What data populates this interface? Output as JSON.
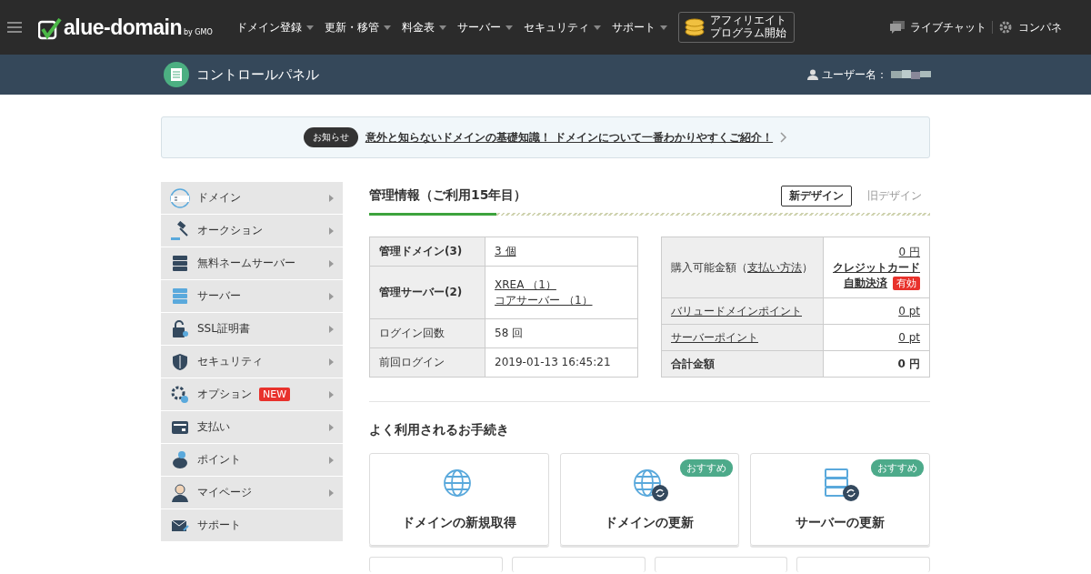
{
  "header": {
    "logo_main": "alue-domain",
    "logo_sub": "by GMO",
    "nav": [
      "ドメイン登録",
      "更新・移管",
      "料金表",
      "サーバー",
      "セキュリティ",
      "サポート"
    ],
    "affiliate": [
      "アフィリエイト",
      "プログラム開始"
    ],
    "live_chat": "ライブチャット",
    "control_panel": "コンパネ"
  },
  "subheader": {
    "title": "コントロールパネル",
    "user_label": "ユーザー名："
  },
  "notice": {
    "badge": "お知らせ",
    "text": "意外と知らないドメインの基礎知識！ ドメインについて一番わかりやすくご紹介！"
  },
  "sidebar": {
    "items": [
      {
        "label": "ドメイン",
        "arrow": true
      },
      {
        "label": "オークション",
        "arrow": true
      },
      {
        "label": "無料ネームサーバー",
        "arrow": true
      },
      {
        "label": "サーバー",
        "arrow": true
      },
      {
        "label": "SSL証明書",
        "arrow": true
      },
      {
        "label": "セキュリティ",
        "arrow": true
      },
      {
        "label": "オプション",
        "arrow": true,
        "badge": "NEW"
      },
      {
        "label": "支払い",
        "arrow": true
      },
      {
        "label": "ポイント",
        "arrow": true
      },
      {
        "label": "マイページ",
        "arrow": true
      },
      {
        "label": "サポート",
        "arrow": false
      }
    ]
  },
  "management": {
    "title": "管理情報（ご利用15年目）",
    "design_tabs": [
      {
        "label": "新デザイン",
        "selected": true
      },
      {
        "label": "旧デザイン",
        "selected": false
      }
    ],
    "left_table": [
      {
        "label": "管理ドメイン(3)",
        "bold": true,
        "values": [
          "3 個"
        ],
        "link": true
      },
      {
        "label": "管理サーバー(2)",
        "bold": true,
        "values": [
          "XREA （1）",
          "コアサーバー （1）"
        ],
        "link": true
      },
      {
        "label": "ログイン回数",
        "bold": false,
        "values": [
          "58 回"
        ],
        "link": false
      },
      {
        "label": "前回ログイン",
        "bold": false,
        "values": [
          "2019-01-13 16:45:21"
        ],
        "link": false
      }
    ],
    "balance": {
      "label": "購入可能金額（",
      "label_link": "支払い方法",
      "label_end": "）",
      "amount": "0 円",
      "method": "クレジットカード",
      "auto": "自動決済",
      "status": "有効"
    },
    "right_rows": [
      {
        "label": "バリュードメインポイント",
        "value": "0 pt",
        "kind": "link"
      },
      {
        "label": "サーバーポイント",
        "value": "0 pt",
        "kind": "link"
      },
      {
        "label": "合計金額",
        "value": "0 円",
        "kind": "total"
      }
    ]
  },
  "procedures": {
    "title": "よく利用されるお手続き",
    "cards": [
      {
        "label": "ドメインの新規取得",
        "kind": "globe",
        "refresh": false
      },
      {
        "label": "ドメインの更新",
        "kind": "globe",
        "refresh": true,
        "badge": "おすすめ"
      },
      {
        "label": "サーバーの更新",
        "kind": "server",
        "refresh": true,
        "badge": "おすすめ"
      }
    ]
  }
}
